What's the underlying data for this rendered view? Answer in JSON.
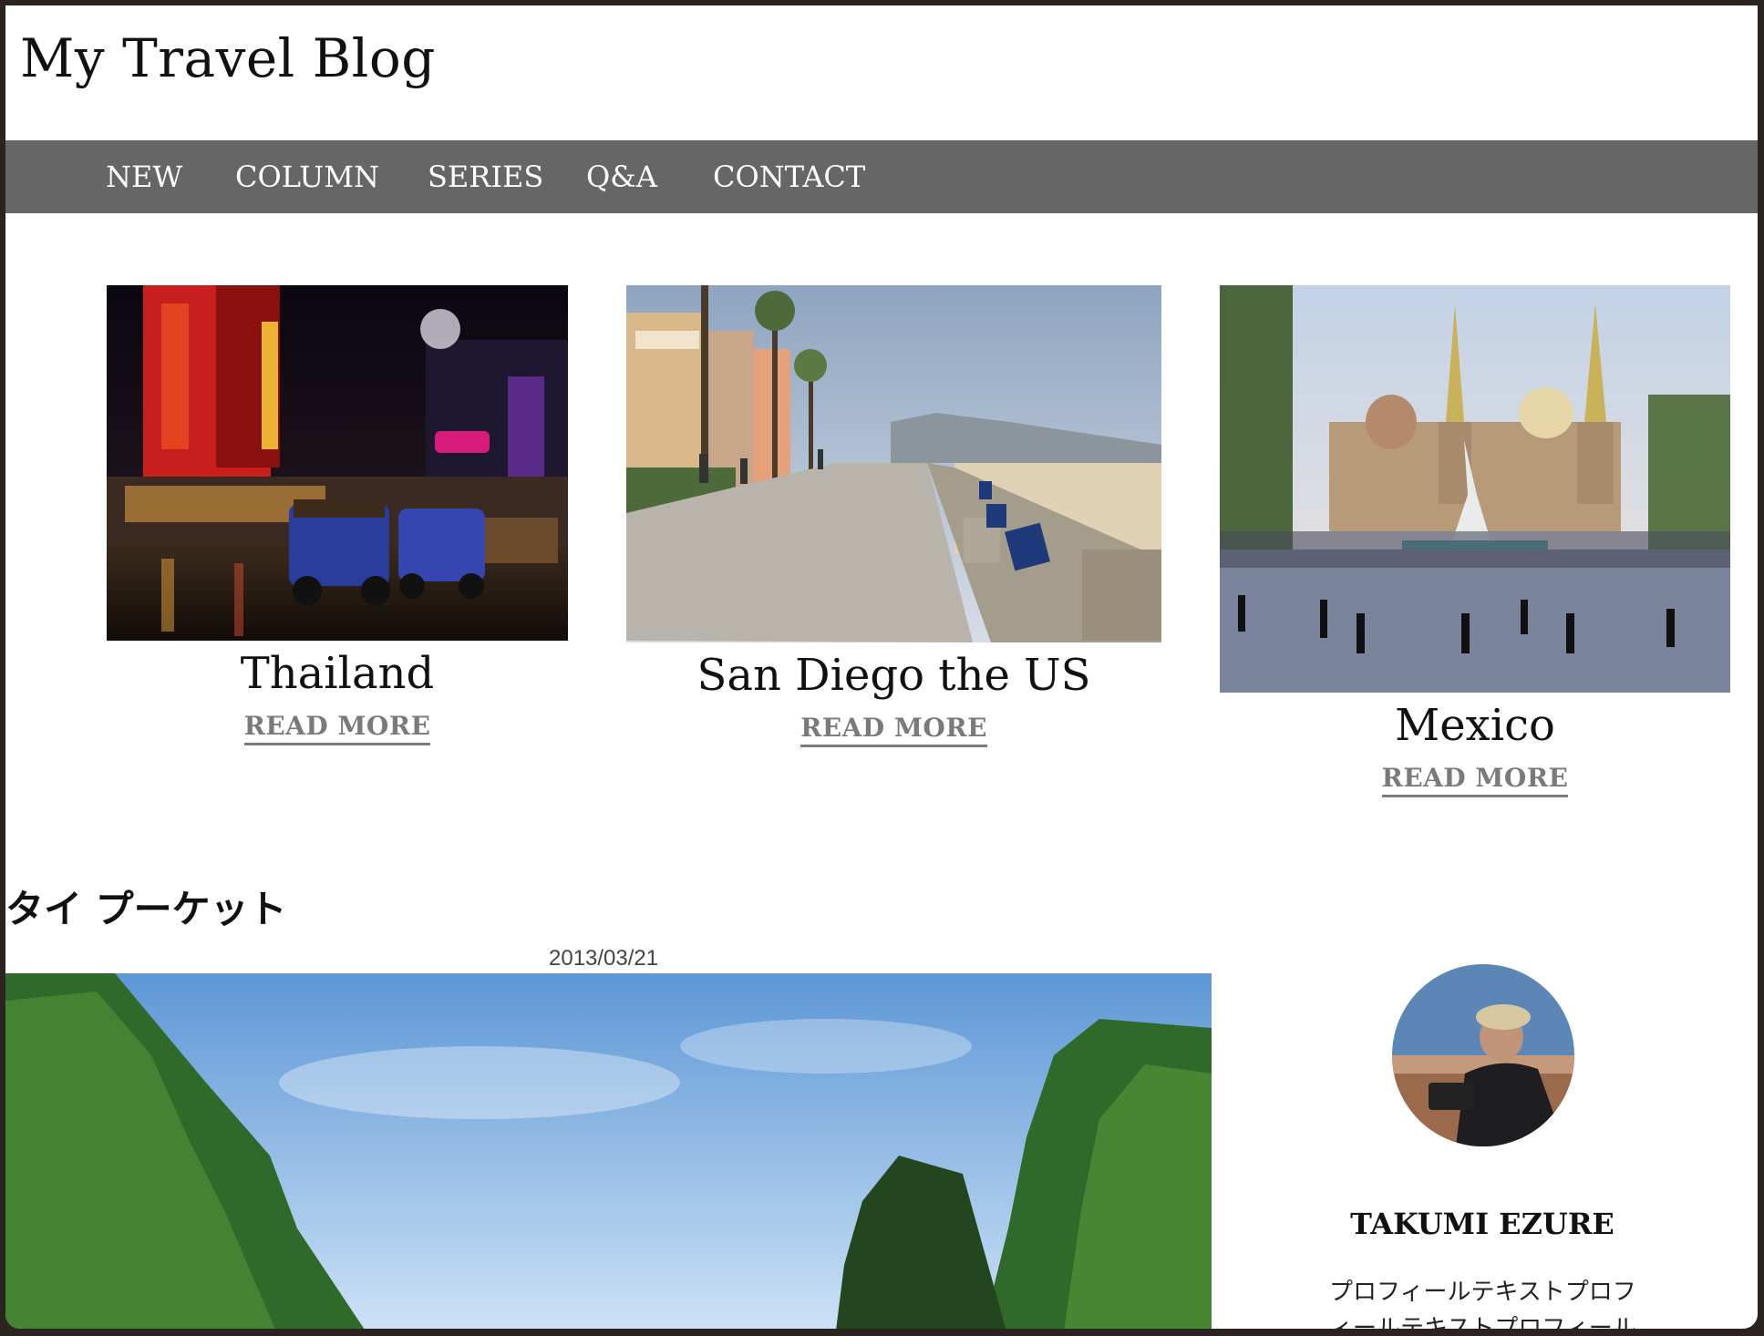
{
  "site": {
    "title": "My Travel Blog"
  },
  "nav": {
    "items": [
      "NEW",
      "COLUMN",
      "SERIES",
      "Q&A",
      "CONTACT"
    ]
  },
  "cards": [
    {
      "title": "Thailand",
      "link": "READ MORE"
    },
    {
      "title": "San Diego the US",
      "link": "READ MORE"
    },
    {
      "title": "Mexico",
      "link": "READ MORE"
    }
  ],
  "post": {
    "title": "タイ プーケット",
    "date": "2013/03/21"
  },
  "profile": {
    "name": "TAKUMI EZURE",
    "text": "プロフィールテキストプロフィールテキストプロフィール"
  },
  "colors": {
    "nav_bg": "#666666",
    "link": "#7a7a7a",
    "frame": "#2b2320"
  }
}
